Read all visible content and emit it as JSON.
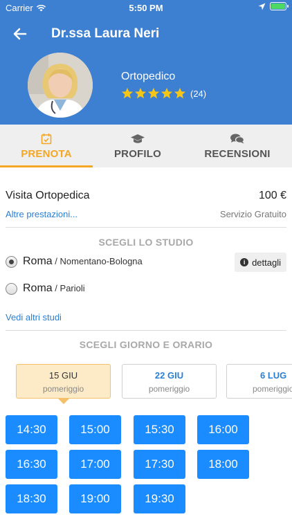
{
  "status_bar": {
    "carrier": "Carrier",
    "time": "5:50 PM"
  },
  "header": {
    "doctor_name": "Dr.ssa Laura Neri",
    "specialty": "Ortopedico",
    "rating_stars": 5,
    "rating_count": "(24)",
    "star_color": "#f5c518",
    "background_color": "#3d7fd0"
  },
  "tabs": [
    {
      "label": "PRENOTA",
      "icon": "calendar-check-icon",
      "active": true
    },
    {
      "label": "PROFILO",
      "icon": "graduation-cap-icon",
      "active": false
    },
    {
      "label": "RECENSIONI",
      "icon": "chat-bubbles-icon",
      "active": false
    }
  ],
  "visit": {
    "title": "Visita Ortopedica",
    "price": "100 €",
    "other_services_link": "Altre prestazioni...",
    "service_note": "Servizio Gratuito"
  },
  "studio_section": {
    "title": "SCEGLI LO STUDIO",
    "studios": [
      {
        "city": "Roma",
        "zone": " / Nomentano-Bologna",
        "selected": true
      },
      {
        "city": "Roma",
        "zone": " / Parioli",
        "selected": false
      }
    ],
    "details_label": "dettagli",
    "more_studios_link": "Vedi altri studi"
  },
  "schedule_section": {
    "title": "SCEGLI GIORNO E ORARIO",
    "dates": [
      {
        "date": "15 GIU",
        "period": "pomeriggio",
        "selected": true
      },
      {
        "date": "22 GIU",
        "period": "pomeriggio",
        "selected": false
      },
      {
        "date": "6 LUG",
        "period": "pomeriggio",
        "selected": false
      }
    ],
    "time_slots": [
      "14:30",
      "15:00",
      "15:30",
      "16:00",
      "16:30",
      "17:00",
      "17:30",
      "18:00",
      "18:30",
      "19:00",
      "19:30"
    ]
  },
  "colors": {
    "accent": "#f5a623",
    "link": "#2a7fd4",
    "slot": "#1a8cff"
  }
}
